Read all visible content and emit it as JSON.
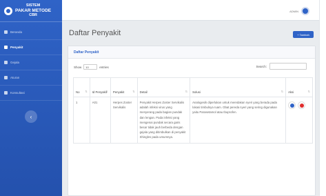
{
  "brand": {
    "line1": "SISTEM",
    "line2": "PAKAR METODE",
    "line3": "CBR"
  },
  "nav": [
    {
      "label": "Beranda"
    },
    {
      "label": "Penyakit"
    },
    {
      "label": "Gejala"
    },
    {
      "label": "Aturan"
    },
    {
      "label": "Konsultasi"
    }
  ],
  "sidebar_toggle": "‹",
  "topbar": {
    "user": "ADMIN"
  },
  "page": {
    "title": "Daftar Penyakit",
    "add_button": "+ Tambah"
  },
  "card": {
    "title": "Daftar Penyakit"
  },
  "controls": {
    "show_label": "Show",
    "show_value": "10",
    "entries_label": "entries",
    "search_label": "Search:"
  },
  "table": {
    "headers": [
      "No",
      "Id Penyakit",
      "Penyakit",
      "Detail",
      "Solusi",
      "Aksi"
    ],
    "rows": [
      {
        "no": "1",
        "id": "A01",
        "penyakit": "Herpes Zoster Servikalis",
        "detail": "Penyakit Herpes Zoster Servikalis adalah infeksi virus yang menyerang pada bagian pundak dan lengan. Pada infeksi yang mengenai pundak secara garis besar tidak jauh berbeda dengan gejala yang ditimbulkan di penyakit Shingles pada umumnya.",
        "solusi": "Analogesik diperlukan untuk meredakan nyeri yang berada pada lokasi timbulnya ruam. Obat pereda nyeri yang sering digunakan yaitu Parasetamol atau Ibuprofen."
      }
    ]
  },
  "colors": {
    "primary": "#2f63c7",
    "danger": "#e02d2d"
  }
}
